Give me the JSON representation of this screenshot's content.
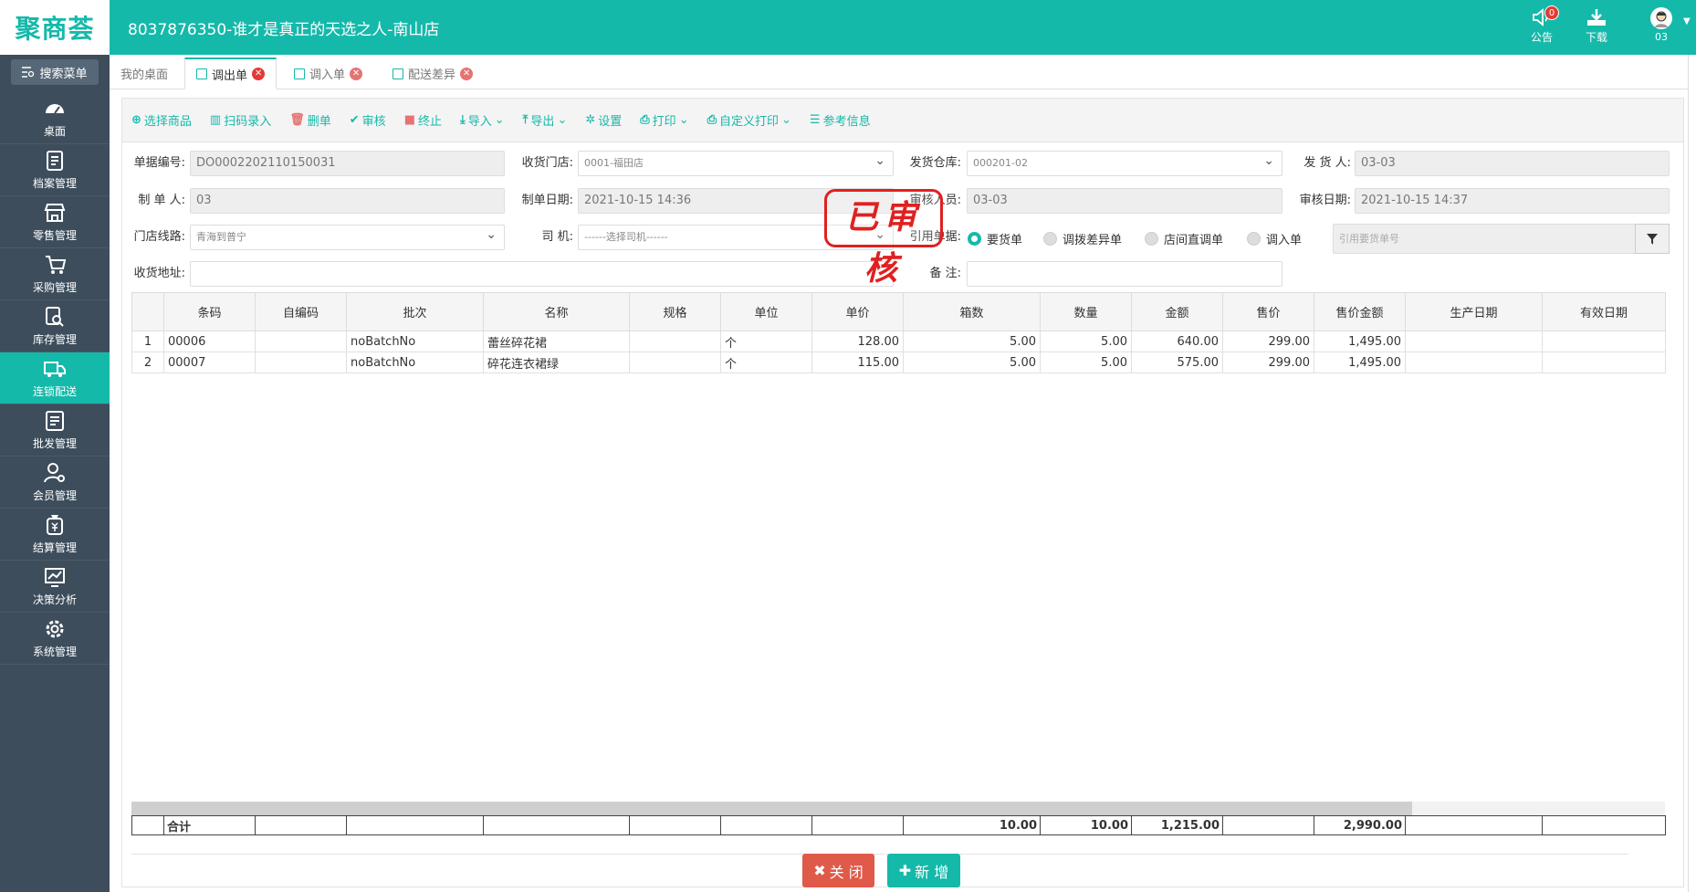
{
  "app": {
    "logo_text": "聚商荟",
    "window_title": "8037876350-谁才是真正的天选之人-南山店",
    "notice_label": "公告",
    "notice_count": "0",
    "download_label": "下载",
    "user_label": "03"
  },
  "sidebar": {
    "search_label": "搜索菜单",
    "items": [
      {
        "label": "桌面",
        "icon": "dashboard-icon"
      },
      {
        "label": "档案管理",
        "icon": "archive-icon"
      },
      {
        "label": "零售管理",
        "icon": "store-icon"
      },
      {
        "label": "采购管理",
        "icon": "cart-icon"
      },
      {
        "label": "库存管理",
        "icon": "inventory-search-icon"
      },
      {
        "label": "连锁配送",
        "icon": "truck-icon"
      },
      {
        "label": "批发管理",
        "icon": "wholesale-icon"
      },
      {
        "label": "会员管理",
        "icon": "member-icon"
      },
      {
        "label": "结算管理",
        "icon": "money-bag-icon"
      },
      {
        "label": "决策分析",
        "icon": "chart-icon"
      },
      {
        "label": "系统管理",
        "icon": "gear-icon"
      }
    ],
    "active_index": 5
  },
  "tabs": [
    {
      "label": "我的桌面"
    },
    {
      "label": "调出单"
    },
    {
      "label": "调入单"
    },
    {
      "label": "配送差异"
    }
  ],
  "toolbar": {
    "select_goods": "选择商品",
    "scan_entry": "扫码录入",
    "delete": "删单",
    "approve": "审核",
    "terminate": "终止",
    "import": "导入",
    "export": "导出",
    "settings": "设置",
    "print": "打印",
    "custom_print": "自定义打印",
    "reference_info": "参考信息"
  },
  "form": {
    "doc_no_label": "单据编号:",
    "doc_no": "DO0002202110150031",
    "receive_store_label": "收货门店:",
    "receive_store": "0001-福田店",
    "ship_warehouse_label": "发货仓库:",
    "ship_warehouse": "000201-02",
    "shipper_label": "发 货 人:",
    "shipper": "03-03",
    "creator_label": "制 单 人:",
    "creator": "03",
    "create_date_label": "制单日期:",
    "create_date": "2021-10-15 14:36",
    "approver_label": "审核人员:",
    "approver": "03-03",
    "approve_date_label": "审核日期:",
    "approve_date": "2021-10-15 14:37",
    "route_label": "门店线路:",
    "route": "青海到普宁",
    "driver_label": "司 机:",
    "driver_placeholder": "------选择司机------",
    "ref_type_label": "引用单据:",
    "ref_options": [
      "要货单",
      "调拨差异单",
      "店间直调单",
      "调入单"
    ],
    "ref_selected": "要货单",
    "ref_no_placeholder": "引用要货单号",
    "address_label": "收货地址:",
    "address": "",
    "remark_label": "备 注:",
    "remark": ""
  },
  "stamp": "已审核",
  "table": {
    "columns": [
      "",
      "条码",
      "自编码",
      "批次",
      "名称",
      "规格",
      "单位",
      "单价",
      "箱数",
      "数量",
      "金额",
      "售价",
      "售价金额",
      "生产日期",
      "有效日期"
    ],
    "rows": [
      [
        "1",
        "00006",
        "",
        "noBatchNo",
        "蕾丝碎花裙",
        "",
        "个",
        "128.00",
        "5.00",
        "5.00",
        "640.00",
        "299.00",
        "1,495.00",
        "",
        ""
      ],
      [
        "2",
        "00007",
        "",
        "noBatchNo",
        "碎花连衣裙绿",
        "",
        "个",
        "115.00",
        "5.00",
        "5.00",
        "575.00",
        "299.00",
        "1,495.00",
        "",
        ""
      ]
    ],
    "totals": [
      "",
      "合计",
      "",
      "",
      "",
      "",
      "",
      "",
      "10.00",
      "10.00",
      "1,215.00",
      "",
      "2,990.00",
      "",
      ""
    ]
  },
  "footer": {
    "close_label": "关 闭",
    "new_label": "新 增"
  },
  "colors": {
    "brand": "#15b9aa",
    "sidebar": "#3d4d5c",
    "danger": "#e05a4a",
    "stamp": "#e02020"
  }
}
